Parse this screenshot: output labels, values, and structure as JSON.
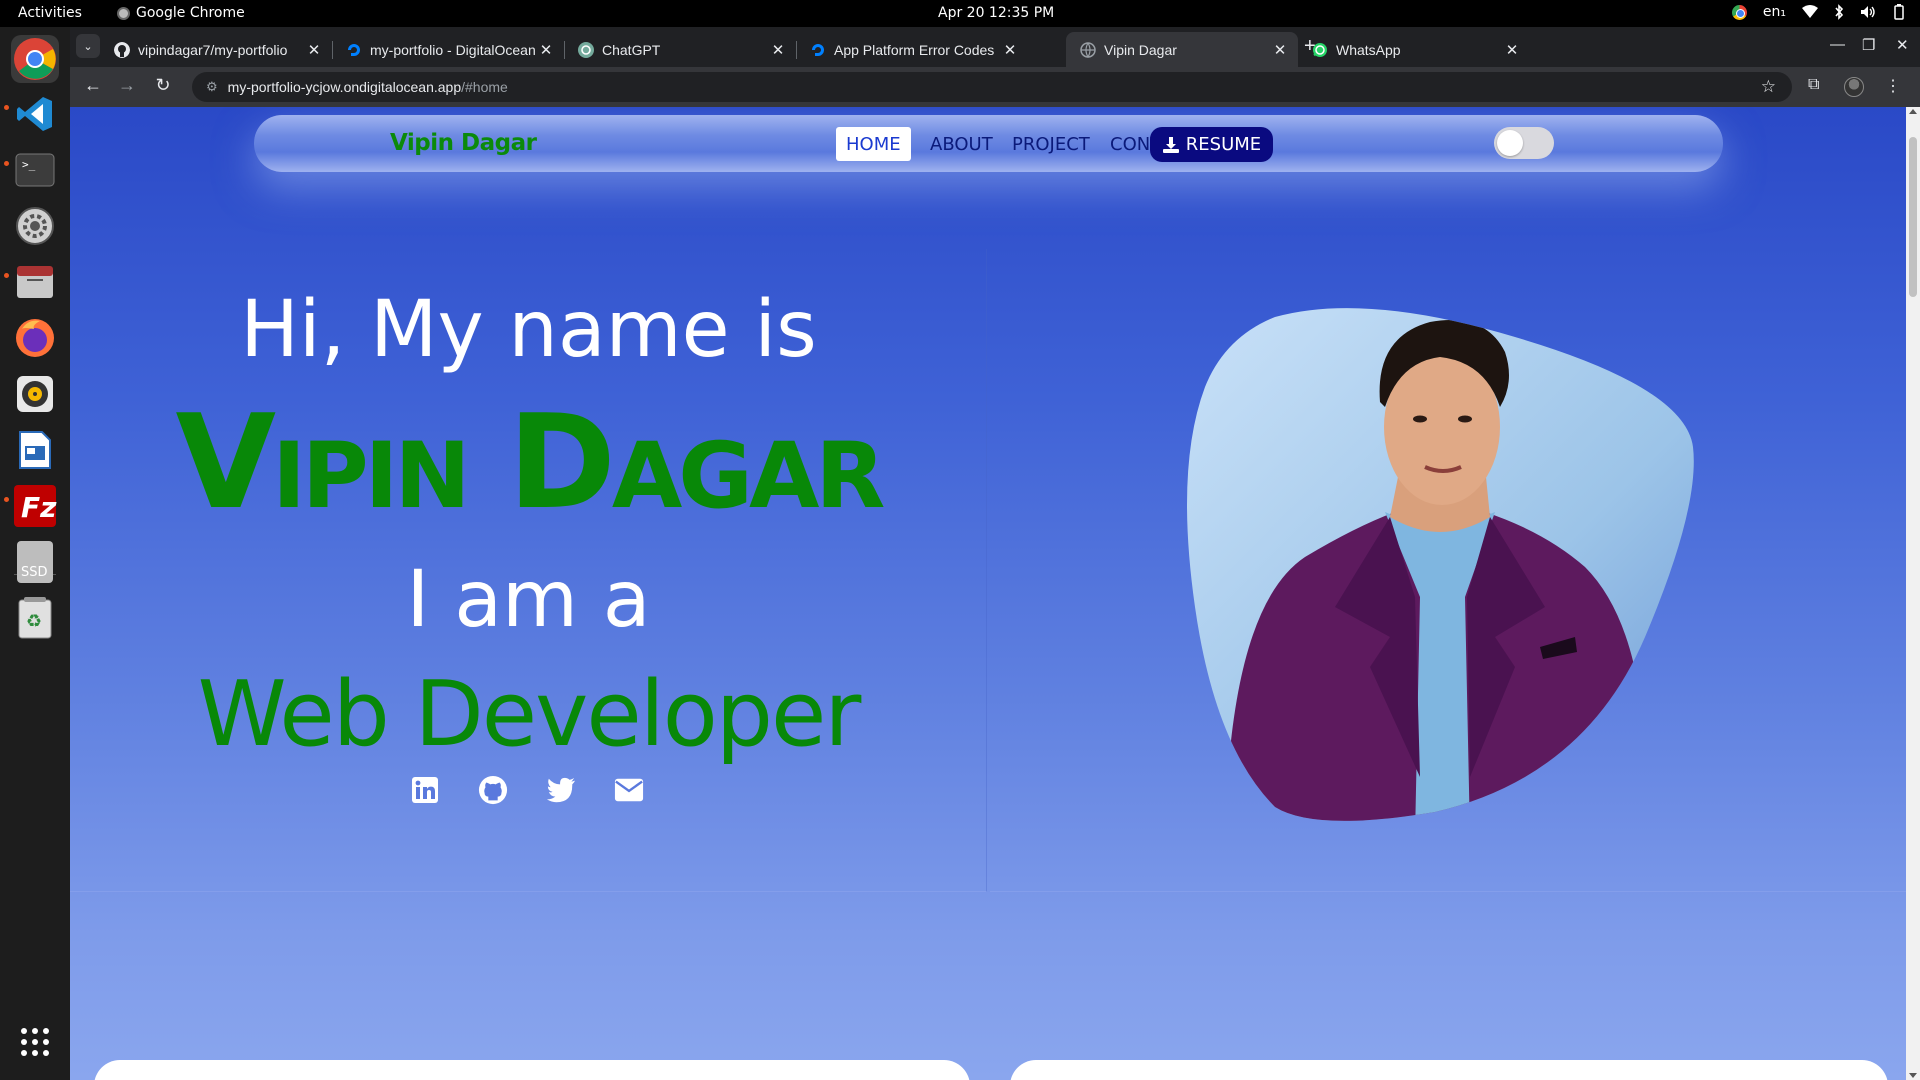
{
  "os": {
    "activities": "Activities",
    "app_name": "Google Chrome",
    "clock": "Apr 20  12:35 PM",
    "keyboard_layout": "en₁"
  },
  "browser": {
    "tabs": [
      {
        "title": "vipindagar7/my-portfolio",
        "icon": "github-icon"
      },
      {
        "title": "my-portfolio - DigitalOcean",
        "icon": "digitalocean-icon"
      },
      {
        "title": "ChatGPT",
        "icon": "chatgpt-icon"
      },
      {
        "title": "App Platform Error Codes",
        "icon": "digitalocean-icon"
      },
      {
        "title": "Vipin Dagar",
        "icon": "globe-icon",
        "active": true
      },
      {
        "title": "WhatsApp",
        "icon": "whatsapp-icon"
      }
    ],
    "url_host": "my-portfolio-ycjow.ondigitalocean.app",
    "url_path": "/#home"
  },
  "site": {
    "brand": "Vipin Dagar",
    "nav": {
      "home": "HOME",
      "about": "ABOUT",
      "project": "PROJECT",
      "contact": "CONTACT",
      "resume": "RESUME"
    },
    "theme_toggle_on": false,
    "hero": {
      "greeting": "Hi, My name is",
      "name": "Vipin Dagar",
      "intro": "I am a",
      "role": "Web Developer"
    },
    "socials": [
      "linkedin-icon",
      "github-icon",
      "twitter-icon",
      "envelope-icon"
    ]
  },
  "colors": {
    "accent_green": "#088808",
    "nav_dark": "#0a0a80",
    "page_gradient_top": "#2a49c7",
    "page_gradient_bottom": "#8aa6ee",
    "blazer": "#5d1a5e"
  },
  "dock_apps": [
    "chrome-icon",
    "vscode-icon",
    "terminal-icon",
    "settings-icon",
    "files-icon",
    "firefox-icon",
    "rhythmbox-icon",
    "writer-icon",
    "filezilla-icon",
    "ssd-icon",
    "trash-icon",
    "app-grid-icon"
  ]
}
